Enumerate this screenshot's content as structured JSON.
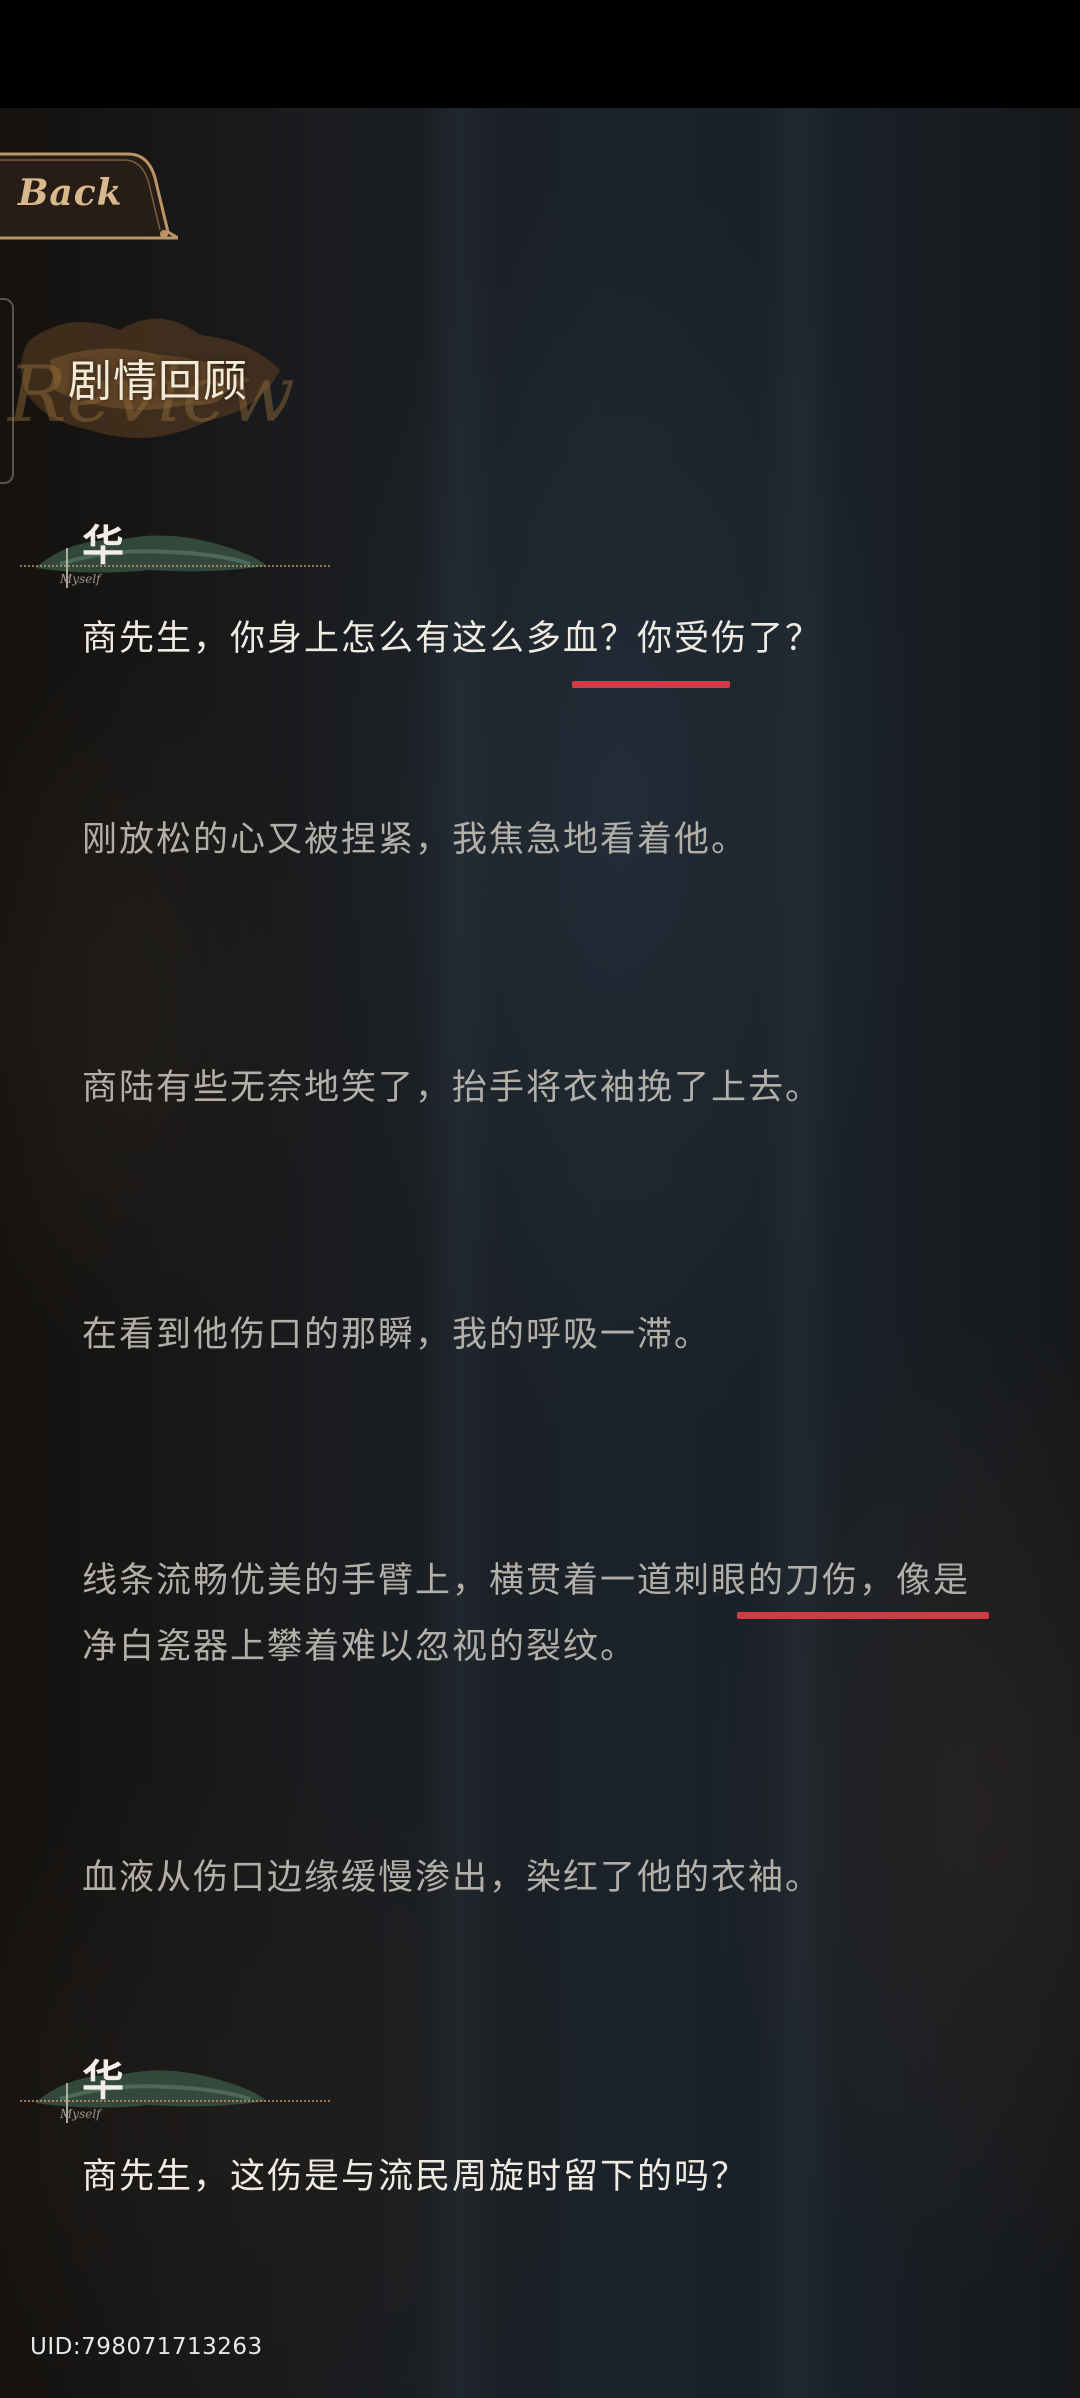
{
  "header": {
    "back_label": "Back",
    "title": "剧情回顾",
    "title_watermark": "Review"
  },
  "story": [
    {
      "type": "dialogue",
      "speaker": "华",
      "signature": "Myself",
      "text": "商先生，你身上怎么有这么多血？你受伤了？"
    },
    {
      "type": "narration",
      "text": "刚放松的心又被捏紧，我焦急地看着他。"
    },
    {
      "type": "narration",
      "text": "商陆有些无奈地笑了，抬手将衣袖挽了上去。"
    },
    {
      "type": "narration",
      "text": "在看到他伤口的那瞬，我的呼吸一滞。"
    },
    {
      "type": "narration",
      "text": "线条流畅优美的手臂上，横贯着一道刺眼的刀伤，像是净白瓷器上攀着难以忽视的裂纹。"
    },
    {
      "type": "narration",
      "text": "血液从伤口边缘缓慢渗出，染红了他的衣袖。"
    },
    {
      "type": "dialogue",
      "speaker": "华",
      "signature": "Myself",
      "text": "商先生，这伤是与流民周旋时留下的吗？"
    }
  ],
  "uid_label": "UID:798071713263",
  "colors": {
    "underline": "#d23b45",
    "gold": "#d8b98c",
    "dialogue_text": "#f0ebe2",
    "narration_text": "#b2aea8"
  }
}
